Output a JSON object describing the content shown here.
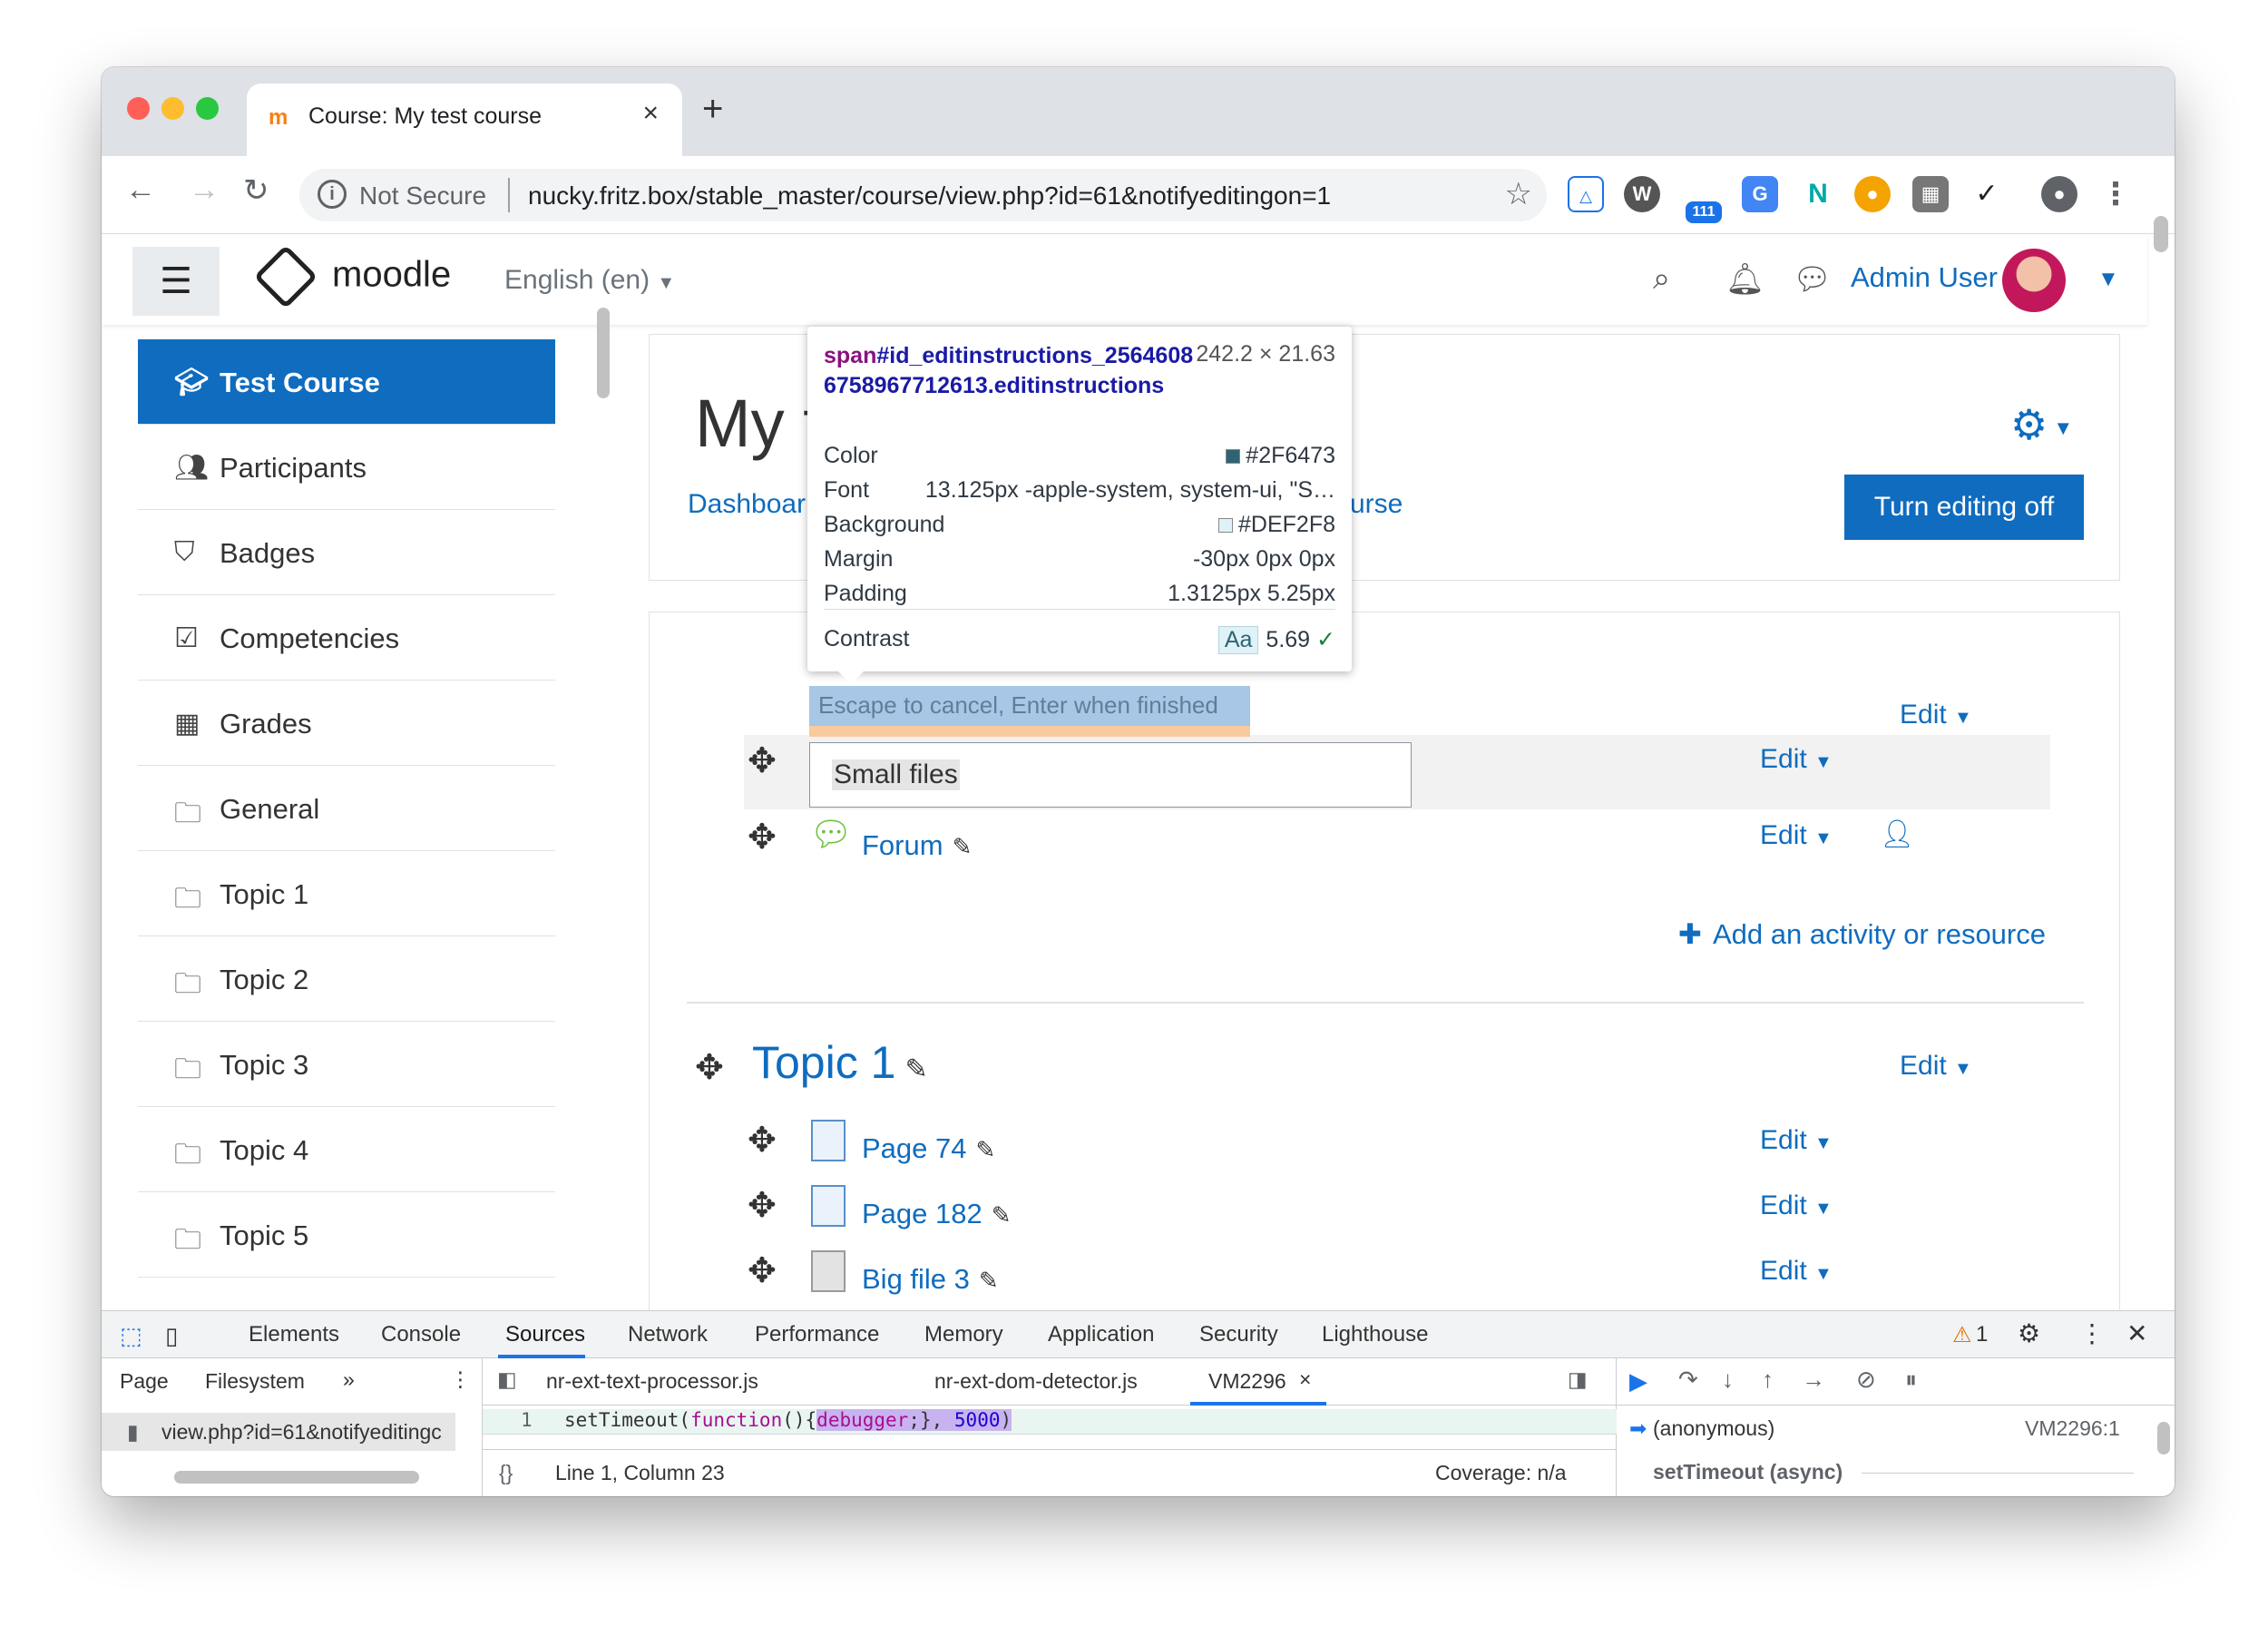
{
  "browser": {
    "tab_title": "Course: My test course",
    "tab_close": "×",
    "new_tab": "+",
    "not_secure": "Not Secure",
    "url": "nucky.fritz.box/stable_master/course/view.php?id=61&notifyeditingon=1",
    "ext_badge": "111"
  },
  "header": {
    "brand": "moodle",
    "language": "English (en)",
    "user": "Admin User"
  },
  "sidebar": {
    "items": [
      {
        "label": "Test Course",
        "icon": "graduation-cap-icon"
      },
      {
        "label": "Participants",
        "icon": "users-icon"
      },
      {
        "label": "Badges",
        "icon": "shield-icon"
      },
      {
        "label": "Competencies",
        "icon": "check-square-icon"
      },
      {
        "label": "Grades",
        "icon": "table-icon"
      },
      {
        "label": "General",
        "icon": "folder-icon"
      },
      {
        "label": "Topic 1",
        "icon": "folder-icon"
      },
      {
        "label": "Topic 2",
        "icon": "folder-icon"
      },
      {
        "label": "Topic 3",
        "icon": "folder-icon"
      },
      {
        "label": "Topic 4",
        "icon": "folder-icon"
      },
      {
        "label": "Topic 5",
        "icon": "folder-icon"
      }
    ]
  },
  "course": {
    "title_partial": "My t",
    "breadcrumb_start": "Dashboar",
    "breadcrumb_end": "urse",
    "edit_toggle": "Turn editing off"
  },
  "section0": {
    "edit": "Edit",
    "edit_instructions": "Escape to cancel, Enter when finished",
    "input_value": "Small files",
    "activities": [
      {
        "label": "Forum",
        "edit": "Edit"
      }
    ],
    "add_activity": "Add an activity or resource"
  },
  "section1": {
    "title": "Topic 1",
    "edit": "Edit",
    "activities": [
      {
        "label": "Page 74",
        "edit": "Edit"
      },
      {
        "label": "Page 182",
        "edit": "Edit"
      },
      {
        "label": "Big file 3",
        "edit": "Edit"
      }
    ]
  },
  "inspector_tooltip": {
    "tag": "span",
    "selector": "#id_editinstructions_25646086758967712613.editinstructions",
    "size": "242.2 × 21.63",
    "rows": [
      {
        "key": "Color",
        "value": "#2F6473",
        "swatch": "#2F6473"
      },
      {
        "key": "Font",
        "value": "13.125px -apple-system, system-ui, \"S…"
      },
      {
        "key": "Background",
        "value": "#DEF2F8",
        "swatch": "#DEF2F8"
      },
      {
        "key": "Margin",
        "value": "-30px 0px 0px"
      },
      {
        "key": "Padding",
        "value": "1.3125px 5.25px"
      }
    ],
    "contrast_label": "Contrast",
    "contrast_aa": "Aa",
    "contrast_value": "5.69"
  },
  "devtools": {
    "tabs": [
      "Elements",
      "Console",
      "Sources",
      "Network",
      "Performance",
      "Memory",
      "Application",
      "Security",
      "Lighthouse"
    ],
    "active_tab": "Sources",
    "warnings": "1",
    "nav_tabs": [
      "Page",
      "Filesystem",
      "»"
    ],
    "file": "view.php?id=61&notifyeditingc",
    "editor_tabs": [
      "nr-ext-text-processor.js",
      "nr-ext-dom-detector.js",
      "VM2296"
    ],
    "line_number": "1",
    "code": {
      "p1": "setTimeout(",
      "p2": "function",
      "p3": "(){",
      "p4": "debugger",
      "p5": ";}, ",
      "p6": "5000",
      "p7": ")"
    },
    "status_left": "Line 1, Column 23",
    "status_right": "Coverage: n/a",
    "format_btn": "{}",
    "callstack": [
      {
        "name": "(anonymous)",
        "loc": "VM2296:1"
      },
      {
        "name": "setTimeout (async)",
        "loc": ""
      }
    ]
  }
}
